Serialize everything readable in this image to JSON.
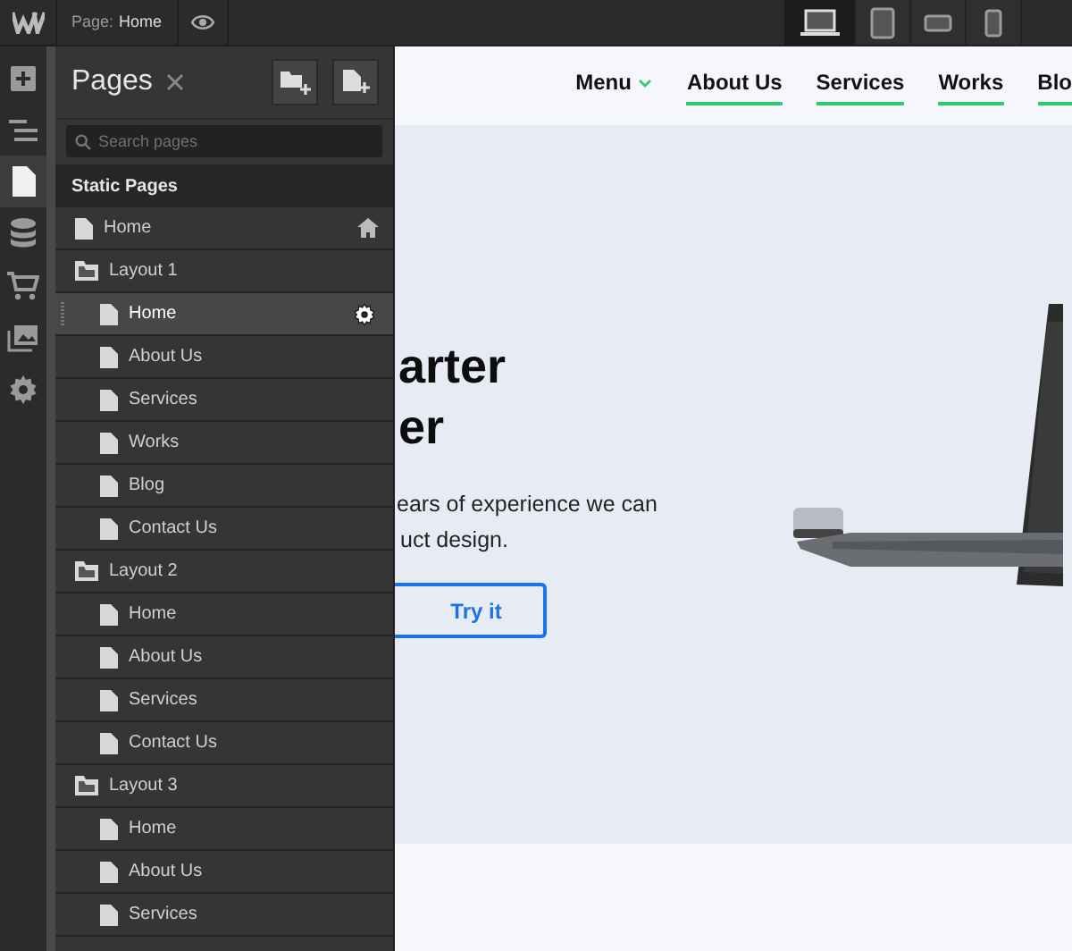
{
  "topbar": {
    "page_label": "Page:",
    "page_name": "Home",
    "devices": [
      {
        "kind": "desktop",
        "selected": true
      },
      {
        "kind": "tablet",
        "selected": false
      },
      {
        "kind": "landscape",
        "selected": false
      },
      {
        "kind": "phone",
        "selected": false
      }
    ]
  },
  "toolbar": [
    {
      "kind": "add",
      "selected": false
    },
    {
      "kind": "navigator",
      "selected": false
    },
    {
      "kind": "pages",
      "selected": true
    },
    {
      "kind": "cms",
      "selected": false
    },
    {
      "kind": "ecommerce",
      "selected": false
    },
    {
      "kind": "assets",
      "selected": false
    },
    {
      "kind": "settings",
      "selected": false
    }
  ],
  "panel": {
    "title": "Pages",
    "search": {
      "placeholder": "Search pages"
    },
    "section": "Static Pages",
    "items": [
      {
        "kind": "page",
        "label": "Home",
        "home": true,
        "selected": false
      },
      {
        "kind": "folder",
        "label": "Layout 1",
        "children": [
          {
            "kind": "page",
            "label": "Home",
            "home": false,
            "selected": true
          },
          {
            "kind": "page",
            "label": "About Us",
            "home": false,
            "selected": false
          },
          {
            "kind": "page",
            "label": "Services",
            "home": false,
            "selected": false
          },
          {
            "kind": "page",
            "label": "Works",
            "home": false,
            "selected": false
          },
          {
            "kind": "page",
            "label": "Blog",
            "home": false,
            "selected": false
          },
          {
            "kind": "page",
            "label": "Contact Us",
            "home": false,
            "selected": false
          }
        ]
      },
      {
        "kind": "folder",
        "label": "Layout 2",
        "children": [
          {
            "kind": "page",
            "label": "Home",
            "home": false,
            "selected": false
          },
          {
            "kind": "page",
            "label": "About Us",
            "home": false,
            "selected": false
          },
          {
            "kind": "page",
            "label": "Services",
            "home": false,
            "selected": false
          },
          {
            "kind": "page",
            "label": "Contact Us",
            "home": false,
            "selected": false
          }
        ]
      },
      {
        "kind": "folder",
        "label": "Layout 3",
        "children": [
          {
            "kind": "page",
            "label": "Home",
            "home": false,
            "selected": false
          },
          {
            "kind": "page",
            "label": "About Us",
            "home": false,
            "selected": false
          },
          {
            "kind": "page",
            "label": "Services",
            "home": false,
            "selected": false
          }
        ]
      }
    ]
  },
  "canvas": {
    "nav": [
      {
        "label": "Menu",
        "dropdown": true,
        "underlined": false
      },
      {
        "label": "About Us",
        "dropdown": false,
        "underlined": true
      },
      {
        "label": "Services",
        "dropdown": false,
        "underlined": true
      },
      {
        "label": "Works",
        "dropdown": false,
        "underlined": true
      },
      {
        "label": "Blo",
        "dropdown": false,
        "underlined": true
      }
    ],
    "heading_lines": [
      "arter",
      "er"
    ],
    "text_lines": [
      "ears of experience we can",
      "uct design."
    ],
    "button": "Try it"
  }
}
